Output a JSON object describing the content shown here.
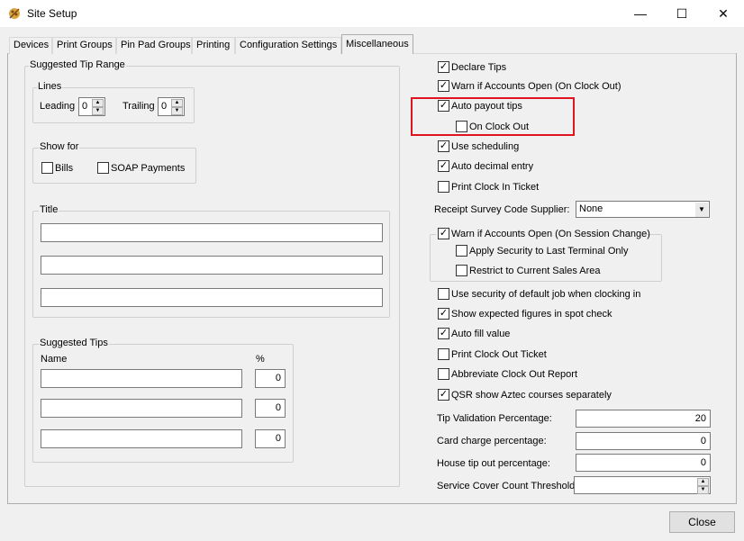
{
  "window": {
    "title": "Site Setup",
    "minimize": "—",
    "maximize": "☐",
    "close": "✕"
  },
  "tabs": [
    "Devices",
    "Print Groups",
    "Pin Pad Groups",
    "Printing",
    "Configuration Settings",
    "Miscellaneous"
  ],
  "left": {
    "tip_range_label": "Suggested Tip Range",
    "lines_label": "Lines",
    "leading_label": "Leading",
    "leading_value": "0",
    "trailing_label": "Trailing",
    "trailing_value": "0",
    "show_for_label": "Show for",
    "bills_label": "Bills",
    "soap_label": "SOAP Payments",
    "title_label": "Title",
    "suggested_tips_label": "Suggested Tips",
    "name_header": "Name",
    "pct_header": "%",
    "tip_rows": [
      {
        "name": "",
        "pct": "0"
      },
      {
        "name": "",
        "pct": "0"
      },
      {
        "name": "",
        "pct": "0"
      }
    ]
  },
  "right": {
    "declare_tips": "Declare Tips",
    "warn_accounts_clock_out": "Warn if Accounts Open (On Clock Out)",
    "auto_payout_tips": "Auto payout tips",
    "on_clock_out": "On Clock Out",
    "use_scheduling": "Use scheduling",
    "auto_decimal_entry": "Auto decimal entry",
    "print_clock_in_ticket": "Print Clock In Ticket",
    "receipt_survey_label": "Receipt Survey Code Supplier:",
    "receipt_survey_value": "None",
    "warn_session_change": "Warn if Accounts Open (On Session Change)",
    "apply_security_last_terminal": "Apply Security to Last Terminal Only",
    "restrict_sales_area": "Restrict to Current Sales Area",
    "use_security_default_job": "Use security of default job when clocking in",
    "show_expected_figures": "Show expected figures in spot check",
    "auto_fill_value": "Auto fill value",
    "print_clock_out_ticket": "Print Clock Out Ticket",
    "abbreviate_clock_out": "Abbreviate Clock Out Report",
    "qsr_aztec_courses": "QSR show Aztec courses separately",
    "tip_validation_label": "Tip Validation Percentage:",
    "tip_validation_value": "20",
    "card_charge_label": "Card charge percentage:",
    "card_charge_value": "0",
    "house_tip_label": "House tip out percentage:",
    "house_tip_value": "0",
    "service_cover_label": "Service Cover Count Threshold:",
    "service_cover_value": ""
  },
  "footer": {
    "close_label": "Close"
  },
  "checkmark": "✓",
  "colors": {
    "highlight": "#e0141e"
  }
}
